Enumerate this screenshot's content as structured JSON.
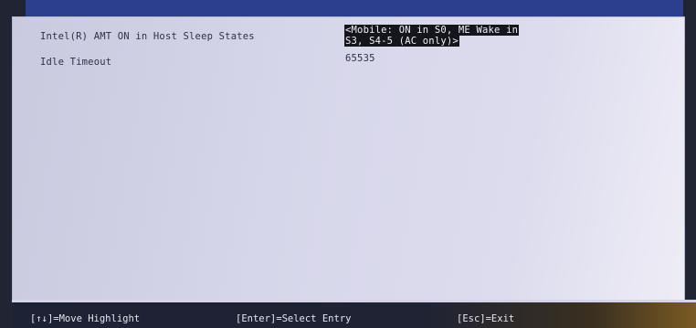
{
  "settings": [
    {
      "label": "Intel(R) AMT ON in Host Sleep States",
      "value_lines": [
        "<Mobile: ON in S0, ME Wake in",
        "S3, S4-5 (AC only)>"
      ],
      "selected": true
    },
    {
      "label": "Idle Timeout",
      "value": "65535",
      "selected": false
    }
  ],
  "footer": {
    "move": "[↑↓]=Move Highlight",
    "select": "[Enter]=Select Entry",
    "exit": "[Esc]=Exit"
  },
  "colors": {
    "panel_bg": "#d6d6ea",
    "selection_bg": "#15151e",
    "selection_text": "#f1f1f6",
    "text": "#2e3146",
    "footer_bg": "#1f2333"
  }
}
